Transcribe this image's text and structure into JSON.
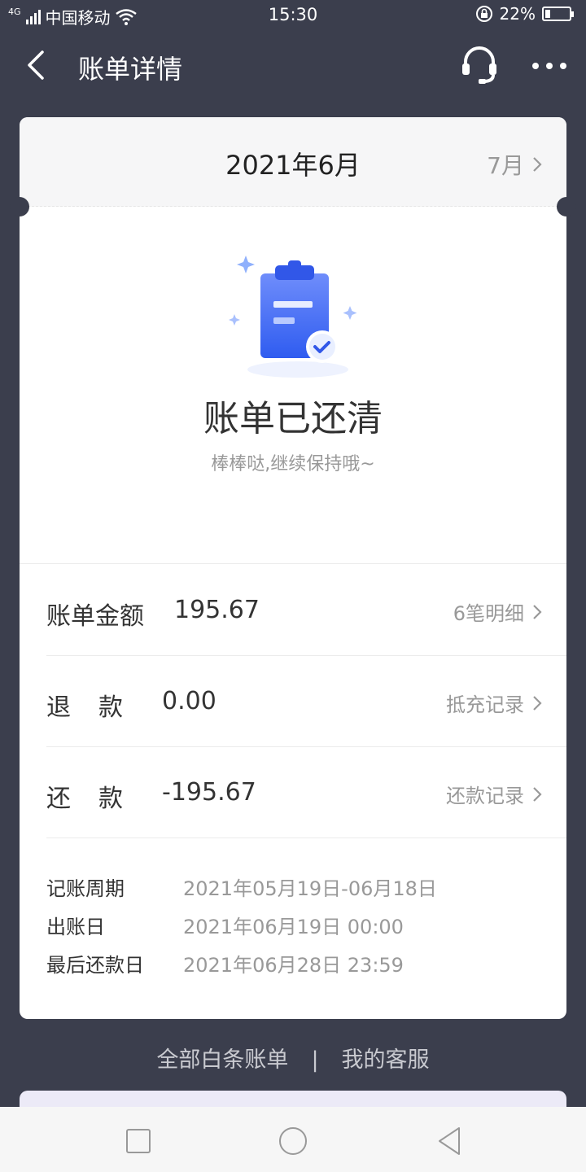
{
  "status_bar": {
    "network": "4G",
    "carrier": "中国移动",
    "time": "15:30",
    "battery": "22%",
    "battery_level": 0.22
  },
  "nav": {
    "title": "账单详情",
    "back_icon": "chevron-left-icon",
    "service_icon": "headset-icon",
    "more_icon": "more-icon"
  },
  "bill": {
    "month": "2021年6月",
    "next_month": "7月",
    "status_title": "账单已还清",
    "status_sub": "棒棒哒,继续保持哦~",
    "rows": [
      {
        "label": "账单金额",
        "amount": "195.67",
        "link": "6笔明细"
      },
      {
        "label": "退　款",
        "amount": "0.00",
        "link": "抵充记录"
      },
      {
        "label": "还　款",
        "amount": "-195.67",
        "link": "还款记录"
      }
    ],
    "info": [
      {
        "key": "记账周期",
        "value": "2021年05月19日-06月18日"
      },
      {
        "key": "出账日",
        "value": "2021年06月19日 00:00"
      },
      {
        "key": "最后还款日",
        "value": "2021年06月28日 23:59"
      }
    ]
  },
  "footer": {
    "all_bills": "全部白条账单",
    "separator": "|",
    "customer_service": "我的客服"
  },
  "colors": {
    "background": "#3b3e4d",
    "card": "#ffffff",
    "accent": "#3d6cf5"
  }
}
